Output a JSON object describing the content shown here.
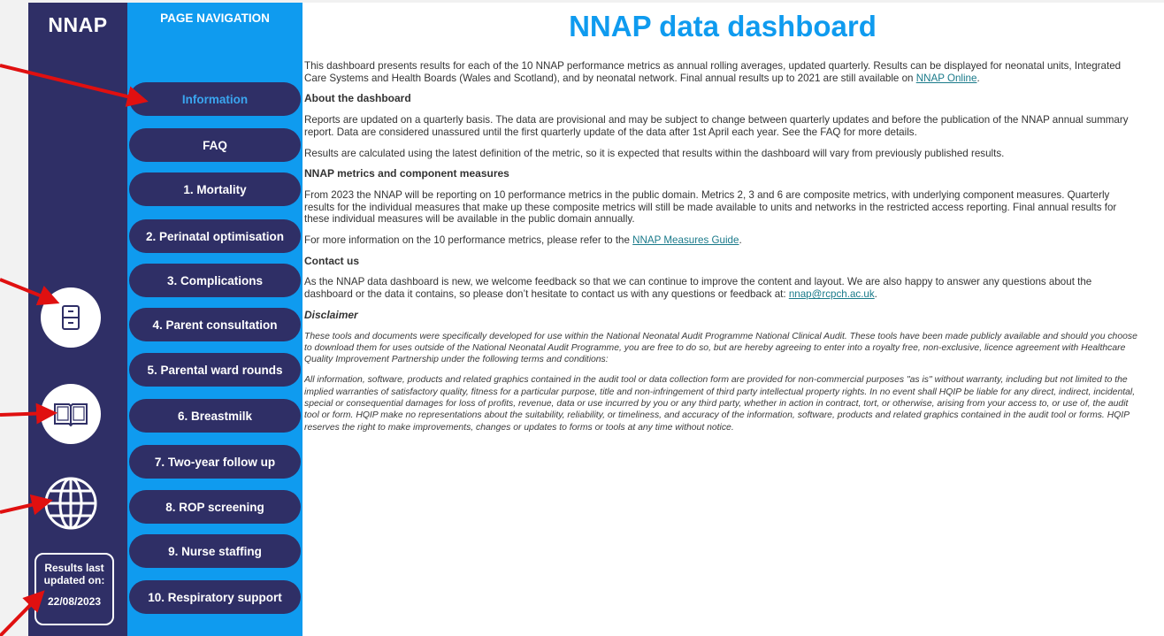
{
  "brand": "NNAP",
  "nav": {
    "title": "PAGE NAVIGATION",
    "items": [
      {
        "label": "Information"
      },
      {
        "label": "FAQ"
      },
      {
        "label": "1. Mortality"
      },
      {
        "label": "2. Perinatal optimisation"
      },
      {
        "label": "3. Complications"
      },
      {
        "label": "4. Parent consultation"
      },
      {
        "label": "5. Parental ward rounds"
      },
      {
        "label": "6. Breastmilk"
      },
      {
        "label": "7. Two-year follow up"
      },
      {
        "label": "8. ROP screening"
      },
      {
        "label": "9. Nurse staffing"
      },
      {
        "label": "10. Respiratory support"
      }
    ]
  },
  "side_icons": [
    "document-icon",
    "book-icon",
    "globe-icon"
  ],
  "results": {
    "line1": "Results last",
    "line2": "updated on:",
    "date": "22/08/2023"
  },
  "content": {
    "title": "NNAP data dashboard",
    "intro": "This dashboard presents results for each of the 10 NNAP performance metrics as annual rolling averages, updated quarterly. Results can be displayed for neonatal units, Integrated Care Systems and Health Boards (Wales and Scotland), and by neonatal network. Final annual results up to 2021 are still available on ",
    "intro_link": "NNAP Online",
    "intro_end": ".",
    "about_heading": "About the dashboard",
    "about_p1": "Reports are updated on a quarterly basis. The data are provisional and may be subject to change between quarterly updates and before the publication of the NNAP annual summary report. Data are considered unassured until the first quarterly update of the data after 1st April each year. See the FAQ for more details.",
    "about_p2": "Results are calculated using the latest definition of the metric, so it is expected that results within the dashboard will vary from previously published results.",
    "metrics_heading": "NNAP metrics and component measures",
    "metrics_p1": "From 2023 the NNAP will be reporting on 10 performance metrics in the public domain. Metrics 2, 3 and 6 are composite metrics, with underlying component measures. Quarterly results for the individual measures that make up these composite metrics will still be made available to units and networks in the restricted access reporting. Final annual results for these individual measures will be available in the public domain annually.",
    "metrics_p2": "For more information on the 10 performance metrics, please refer to the ",
    "metrics_link": "NNAP Measures Guide",
    "metrics_p2_end": ".",
    "contact_heading": "Contact us",
    "contact_p": "As the NNAP data dashboard is new, we welcome feedback so that we can continue to improve the content and layout. We are also happy to answer any questions about the dashboard or the data it contains, so please don’t hesitate to contact us with any questions or feedback at: ",
    "contact_link": "nnap@rcpch.ac.uk",
    "contact_end": ".",
    "disclaimer_heading": "Disclaimer",
    "disclaimer_p1": "These tools and documents were specifically developed for use within the National Neonatal Audit Programme National Clinical Audit. These tools have been made publicly available and should you choose to download them for uses outside of the National Neonatal Audit Programme, you are free to do so, but are hereby agreeing to enter into a royalty free, non-exclusive, licence agreement with Healthcare Quality Improvement Partnership under the following terms and conditions:",
    "disclaimer_p2": "All information, software, products and related graphics contained in the audit tool or data collection form are provided for non-commercial purposes \"as is\" without warranty, including but not limited to the implied warranties of satisfactory quality, fitness for a particular purpose, title and non-infringement of third party intellectual property rights. In no event shall HQIP be liable for any direct, indirect, incidental, special or consequential damages for loss of profits, revenue, data or use incurred by you or any third party, whether in action in contract, tort, or otherwise, arising from your access to, or use of, the audit tool or form. HQIP make no representations about the suitability, reliability, or timeliness, and accuracy of the information, software, products and related graphics contained in the audit tool or forms. HQIP reserves the right to make improvements, changes or updates to forms or tools at any time without notice."
  },
  "colors": {
    "navy": "#2f2f66",
    "blue": "#0f9bef",
    "arrow": "#e01010"
  }
}
